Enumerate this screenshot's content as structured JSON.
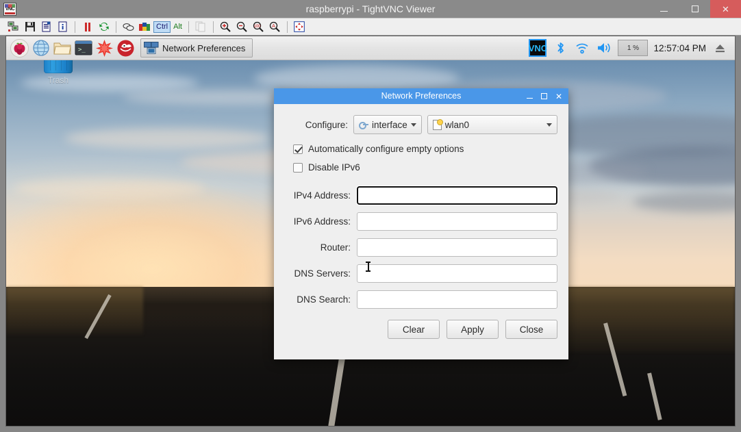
{
  "viewer": {
    "title": "raspberrypi - TightVNC Viewer",
    "app_icon": "vnc-logo-icon",
    "caption": {
      "minimize": "minimize-icon",
      "maximize": "maximize-icon",
      "close": "✕"
    },
    "toolbar": {
      "items": [
        {
          "name": "new-connection-icon",
          "label": ""
        },
        {
          "name": "save-connection-icon",
          "label": ""
        },
        {
          "name": "connection-options-icon",
          "label": ""
        },
        {
          "name": "connection-info-icon",
          "label": ""
        },
        {
          "name": "pause-icon",
          "label": ""
        },
        {
          "name": "refresh-icon",
          "label": ""
        },
        {
          "name": "send-ctrl-alt-del-icon",
          "label": ""
        },
        {
          "name": "send-ctrl-esc-icon",
          "label": ""
        },
        {
          "name": "ctrl-key-toggle",
          "label": "Ctrl"
        },
        {
          "name": "alt-key-toggle",
          "label": "Alt"
        },
        {
          "name": "clipboard-transfer-icon",
          "label": ""
        },
        {
          "name": "zoom-in-icon",
          "label": ""
        },
        {
          "name": "zoom-out-icon",
          "label": ""
        },
        {
          "name": "zoom-100-icon",
          "label": ""
        },
        {
          "name": "zoom-auto-icon",
          "label": ""
        },
        {
          "name": "fullscreen-icon",
          "label": ""
        }
      ]
    }
  },
  "desktop": {
    "trash": {
      "label": "Trash",
      "icon": "trash-can-icon"
    },
    "taskbar": {
      "launchers": [
        {
          "name": "raspberry-menu-icon",
          "title": "Menu"
        },
        {
          "name": "web-browser-icon",
          "title": "Web Browser"
        },
        {
          "name": "file-manager-icon",
          "title": "File Manager"
        },
        {
          "name": "terminal-icon",
          "title": "Terminal"
        },
        {
          "name": "mathematica-icon",
          "title": "Mathematica"
        },
        {
          "name": "wolfram-icon",
          "title": "Wolfram"
        }
      ],
      "task_button": {
        "label": "Network Preferences",
        "icon": "network-monitors-icon"
      },
      "tray": {
        "vnc": "VNC",
        "bluetooth_icon": "bluetooth-icon",
        "wifi_icon": "wifi-icon",
        "volume_icon": "volume-icon",
        "cpu_usage": "1 %",
        "clock": "12:57:04 PM",
        "eject_icon": "eject-icon"
      }
    }
  },
  "dialog": {
    "title": "Network Preferences",
    "caption": {
      "minimize": "minimize-icon",
      "maximize": "maximize-icon",
      "close": "✕"
    },
    "configure_label": "Configure:",
    "interface_select": {
      "value": "interface",
      "icon": "key-icon"
    },
    "device_select": {
      "value": "wlan0",
      "icon": "document-icon"
    },
    "checkboxes": [
      {
        "label": "Automatically configure empty options",
        "checked": true
      },
      {
        "label": "Disable IPv6",
        "checked": false
      }
    ],
    "fields": [
      {
        "label": "IPv4 Address:",
        "value": "",
        "focused": true
      },
      {
        "label": "IPv6 Address:",
        "value": "",
        "focused": false
      },
      {
        "label": "Router:",
        "value": "",
        "focused": false
      },
      {
        "label": "DNS Servers:",
        "value": "",
        "focused": false
      },
      {
        "label": "DNS Search:",
        "value": "",
        "focused": false
      }
    ],
    "buttons": [
      {
        "label": "Clear",
        "name": "clear-button"
      },
      {
        "label": "Apply",
        "name": "apply-button"
      },
      {
        "label": "Close",
        "name": "close-button"
      }
    ]
  },
  "colors": {
    "dialog_titlebar": "#4a97e8",
    "viewer_close": "#d65c5c",
    "focus_border": "#3d7fc7",
    "ctrl_active": "#bfdcf5",
    "trash_blue": "#1b7fc8"
  }
}
